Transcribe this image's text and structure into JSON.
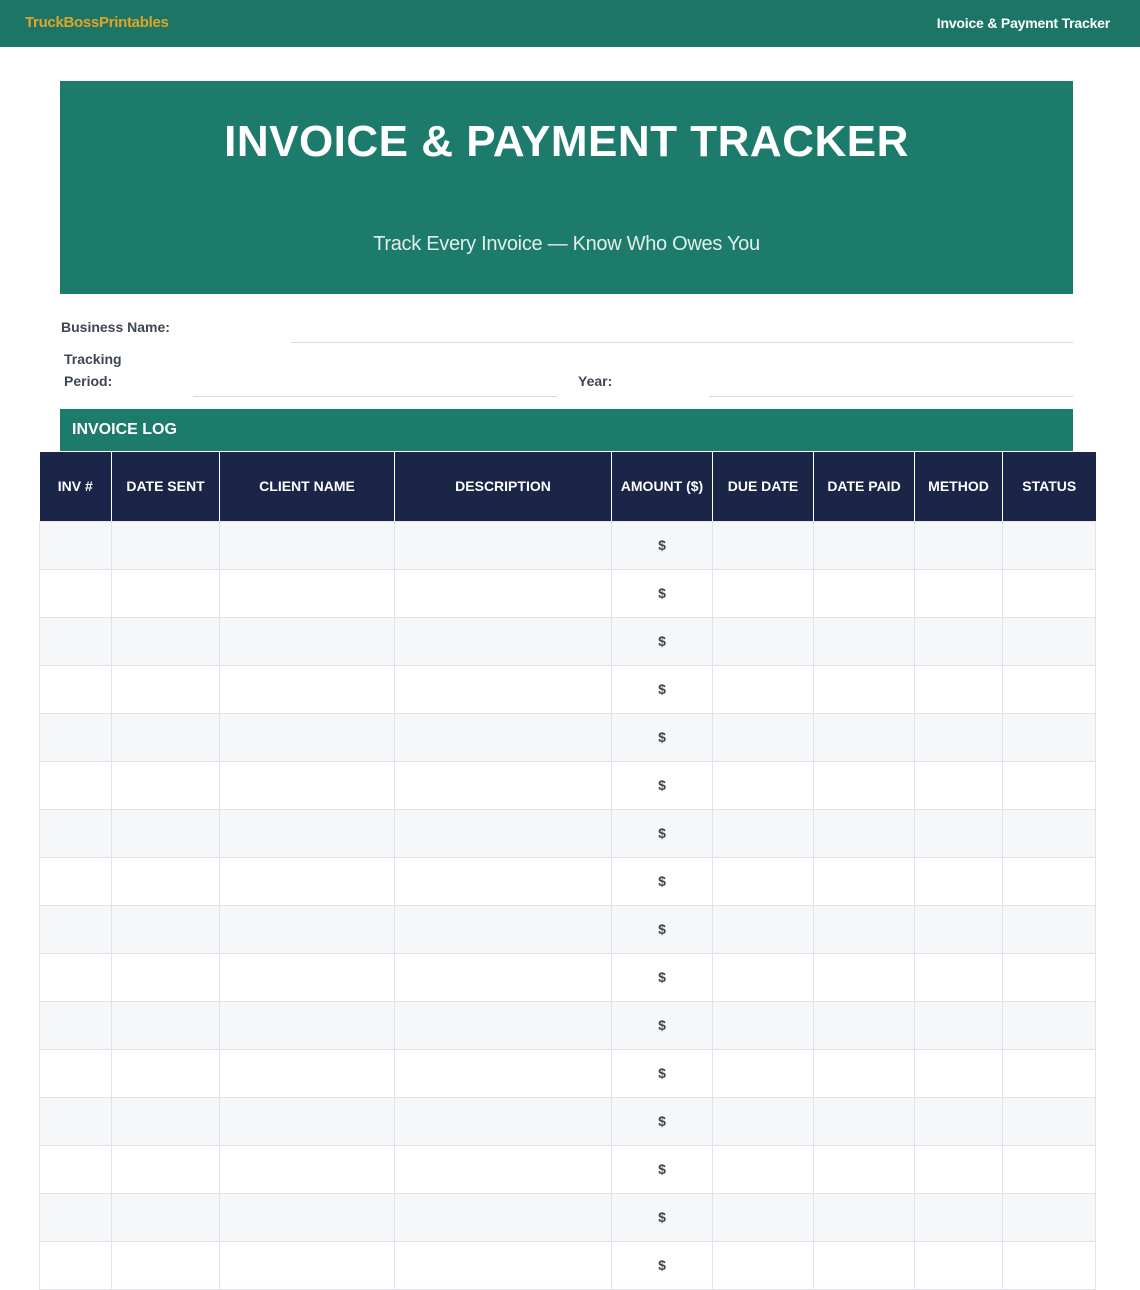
{
  "topbar": {
    "brand": "TruckBossPrintables",
    "title": "Invoice & Payment Tracker"
  },
  "hero": {
    "title": "INVOICE & PAYMENT TRACKER",
    "subtitle": "Track Every Invoice — Know Who Owes You"
  },
  "fields": {
    "business_name_label": "Business Name:",
    "tracking_label_line1": "Tracking",
    "tracking_label_line2": "Period:",
    "year_label": "Year:"
  },
  "section": {
    "title": "INVOICE LOG"
  },
  "table": {
    "headers": [
      "INV #",
      "DATE SENT",
      "CLIENT NAME",
      "DESCRIPTION",
      "AMOUNT ($)",
      "DUE DATE",
      "DATE PAID",
      "METHOD",
      "STATUS"
    ],
    "rows": [
      [
        "",
        "",
        "",
        "",
        "$",
        "",
        "",
        "",
        ""
      ],
      [
        "",
        "",
        "",
        "",
        "$",
        "",
        "",
        "",
        ""
      ],
      [
        "",
        "",
        "",
        "",
        "$",
        "",
        "",
        "",
        ""
      ],
      [
        "",
        "",
        "",
        "",
        "$",
        "",
        "",
        "",
        ""
      ],
      [
        "",
        "",
        "",
        "",
        "$",
        "",
        "",
        "",
        ""
      ],
      [
        "",
        "",
        "",
        "",
        "$",
        "",
        "",
        "",
        ""
      ],
      [
        "",
        "",
        "",
        "",
        "$",
        "",
        "",
        "",
        ""
      ],
      [
        "",
        "",
        "",
        "",
        "$",
        "",
        "",
        "",
        ""
      ],
      [
        "",
        "",
        "",
        "",
        "$",
        "",
        "",
        "",
        ""
      ],
      [
        "",
        "",
        "",
        "",
        "$",
        "",
        "",
        "",
        ""
      ],
      [
        "",
        "",
        "",
        "",
        "$",
        "",
        "",
        "",
        ""
      ],
      [
        "",
        "",
        "",
        "",
        "$",
        "",
        "",
        "",
        ""
      ],
      [
        "",
        "",
        "",
        "",
        "$",
        "",
        "",
        "",
        ""
      ],
      [
        "",
        "",
        "",
        "",
        "$",
        "",
        "",
        "",
        ""
      ],
      [
        "",
        "",
        "",
        "",
        "$",
        "",
        "",
        "",
        ""
      ],
      [
        "",
        "",
        "",
        "",
        "$",
        "",
        "",
        "",
        ""
      ]
    ]
  }
}
